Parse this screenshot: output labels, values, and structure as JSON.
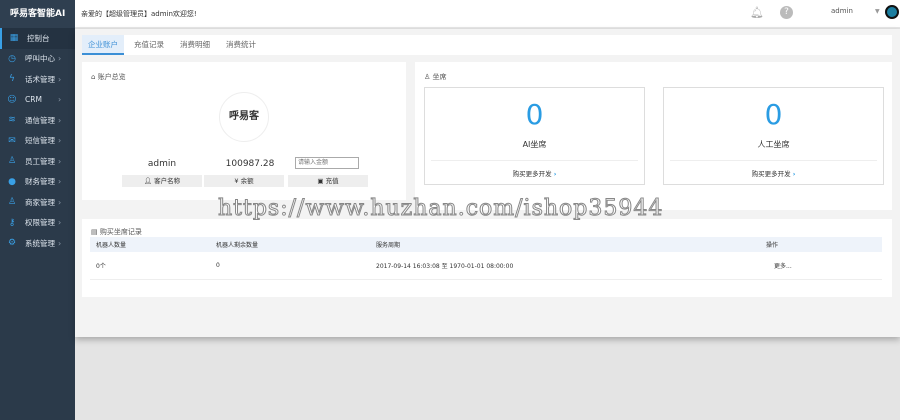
{
  "app": {
    "logo": "呼易客智能AI"
  },
  "sidebar": {
    "items": [
      {
        "label": "控制台",
        "icon": "dashboard-icon",
        "glyph": "▦"
      },
      {
        "label": "呼叫中心",
        "icon": "clock-icon",
        "glyph": "◷"
      },
      {
        "label": "话术管理",
        "icon": "script-icon",
        "glyph": "ϟ"
      },
      {
        "label": "CRM",
        "icon": "users-icon",
        "glyph": "☺"
      },
      {
        "label": "通信管理",
        "icon": "sliders-icon",
        "glyph": "≋"
      },
      {
        "label": "短信管理",
        "icon": "mail-icon",
        "glyph": "✉"
      },
      {
        "label": "员工管理",
        "icon": "user-icon",
        "glyph": "♙"
      },
      {
        "label": "财务管理",
        "icon": "finance-icon",
        "glyph": "●"
      },
      {
        "label": "商家管理",
        "icon": "merchant-icon",
        "glyph": "♙"
      },
      {
        "label": "权限管理",
        "icon": "key-icon",
        "glyph": "⚷"
      },
      {
        "label": "系统管理",
        "icon": "gear-icon",
        "glyph": "⚙"
      }
    ]
  },
  "header": {
    "welcome": "亲爱的【超级管理员】admin欢迎您!",
    "user": "admin"
  },
  "tabs": [
    "企业账户",
    "充值记录",
    "消费明细",
    "消费统计"
  ],
  "account": {
    "title": "账户总览",
    "logo_text": "呼易客",
    "name": "admin",
    "balance": "100987.28",
    "amount_placeholder": "请输入金额",
    "btn_name": "客户名称",
    "btn_balance": "余额",
    "btn_recharge": "充值"
  },
  "seats": {
    "title": "坐席",
    "cards": [
      {
        "count": "0",
        "label": "AI坐席",
        "more": "购买更多开发"
      },
      {
        "count": "0",
        "label": "人工坐席",
        "more": "购买更多开发"
      }
    ]
  },
  "records": {
    "title": "购买坐席记录",
    "columns": [
      "机器人数量",
      "机器人剩余数量",
      "服务周期",
      "操作"
    ],
    "rows": [
      [
        "0个",
        "0",
        "2017-09-14 16:03:08 至 1970-01-01 08:00:00",
        "更多..."
      ]
    ]
  },
  "watermark": "https://www.huzhan.com/ishop35944"
}
